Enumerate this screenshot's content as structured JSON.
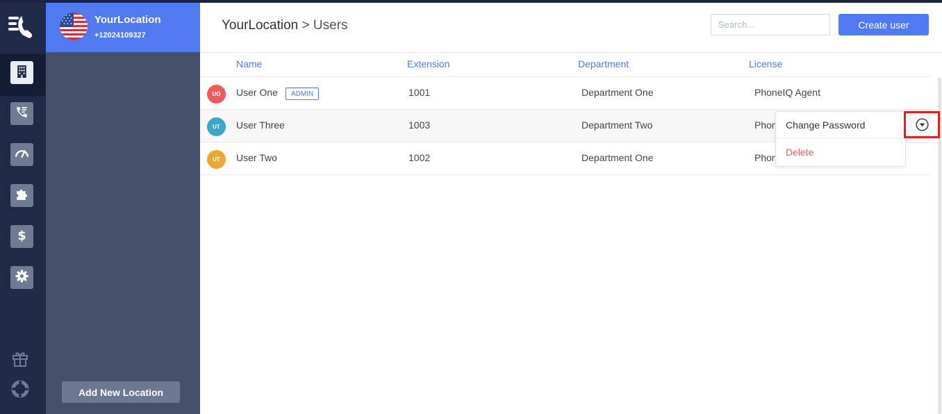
{
  "location": {
    "name": "YourLocation",
    "phone": "+12024109327",
    "add_button": "Add New Location"
  },
  "breadcrumb": {
    "root": "YourLocation",
    "separator": ">",
    "current": "Users"
  },
  "search": {
    "placeholder": "Search..."
  },
  "create_button": "Create user",
  "table": {
    "headers": {
      "name": "Name",
      "extension": "Extension",
      "department": "Department",
      "license": "License"
    },
    "rows": [
      {
        "initials": "UO",
        "name": "User One",
        "badge": "ADMIN",
        "extension": "1001",
        "department": "Department One",
        "license": "PhoneIQ Agent",
        "avatar_color": "#f05a5a"
      },
      {
        "initials": "UT",
        "name": "User Three",
        "extension": "1003",
        "department": "Department Two",
        "license": "Phon",
        "avatar_color": "#3aa6c8"
      },
      {
        "initials": "UT",
        "name": "User Two",
        "extension": "1002",
        "department": "Department One",
        "license": "Phon",
        "avatar_color": "#e9a830"
      }
    ]
  },
  "row_menu": {
    "change_password": "Change Password",
    "delete": "Delete"
  },
  "colors": {
    "accent": "#5179f0",
    "rail": "#1e2a47",
    "panel": "#45516b",
    "danger": "#f05a5a",
    "highlight": "#e02020"
  },
  "icons": [
    "app-logo-icon",
    "building-icon",
    "call-log-icon",
    "speedometer-icon",
    "puzzle-icon",
    "dollar-icon",
    "gear-icon",
    "gift-icon",
    "lifebuoy-icon",
    "chevron-down-circle-icon"
  ]
}
